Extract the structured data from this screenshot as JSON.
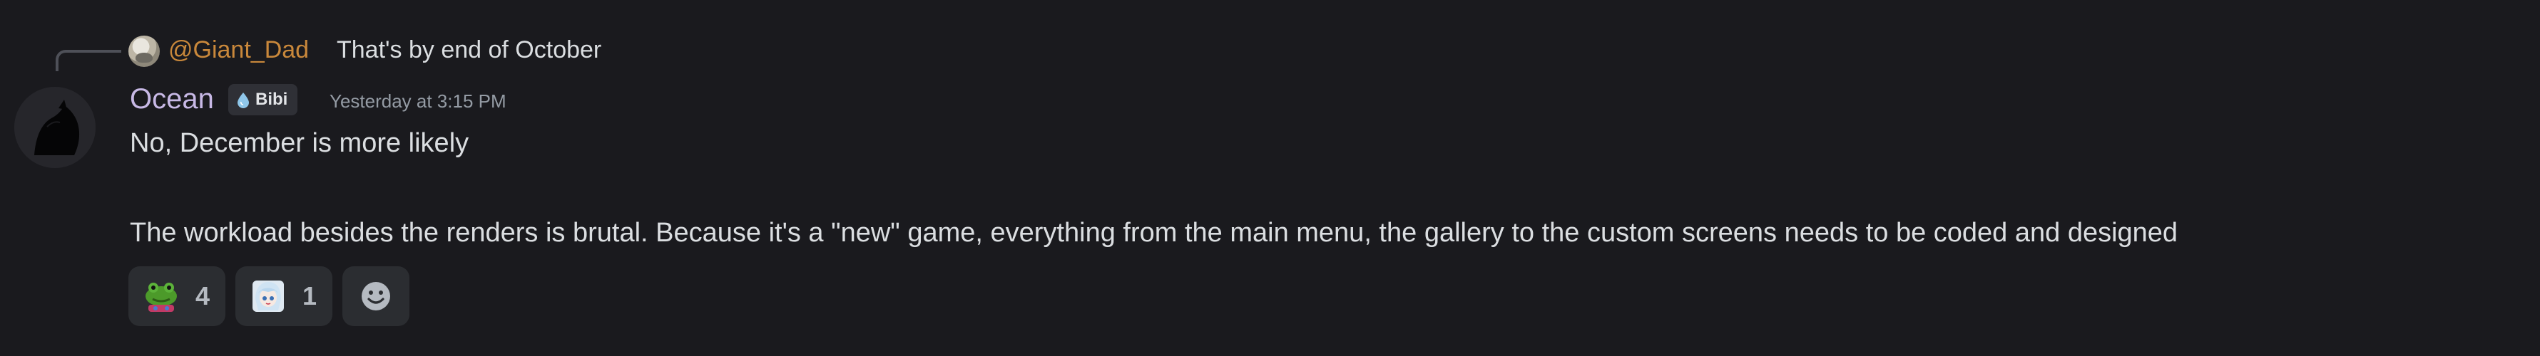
{
  "reply": {
    "author": "@Giant_Dad",
    "text": "That's by end of October"
  },
  "message": {
    "author": "Ocean",
    "role_tag": "Bibi",
    "role_icon": "water-drop-icon",
    "timestamp": "Yesterday at 3:15 PM",
    "line1": "No, December is more likely",
    "line2": "The workload besides the renders is brutal. Because it's a \"new\" game, everything from the main menu, the gallery to the custom screens needs to be coded and designed"
  },
  "reactions": [
    {
      "emoji": "frog-emoji",
      "count": "4"
    },
    {
      "emoji": "anime-girl-emoji",
      "count": "1"
    }
  ],
  "add_reaction_icon": "smiley-add-icon",
  "colors": {
    "background": "#1a1a1e",
    "author_name": "#c8b9e6",
    "reply_author": "#c9883b",
    "text": "#dbdee1",
    "muted": "#949ba4",
    "reaction_bg": "#2b2d31"
  }
}
